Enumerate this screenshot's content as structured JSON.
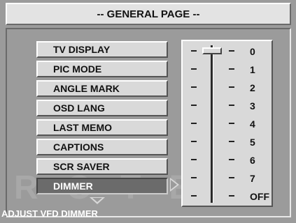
{
  "header": {
    "title": "-- GENERAL PAGE --"
  },
  "menu": {
    "items": [
      {
        "label": "TV DISPLAY"
      },
      {
        "label": "PIC MODE"
      },
      {
        "label": "ANGLE MARK"
      },
      {
        "label": "OSD LANG"
      },
      {
        "label": "LAST MEMO"
      },
      {
        "label": "CAPTIONS"
      },
      {
        "label": "SCR SAVER"
      },
      {
        "label": "DIMMER"
      }
    ],
    "selected_index": 7
  },
  "dimmer_slider": {
    "levels": [
      "0",
      "1",
      "2",
      "3",
      "4",
      "5",
      "6",
      "7",
      "OFF"
    ],
    "current_value": "0"
  },
  "status": {
    "text": "ADJUST VFD DIMMER"
  },
  "watermark": {
    "text": "ROTEL"
  },
  "colors": {
    "background": "#9b9b9b",
    "button_face": "#d9d9d9",
    "selected_button": "#6b6b6b",
    "status_text": "#ffffff"
  }
}
